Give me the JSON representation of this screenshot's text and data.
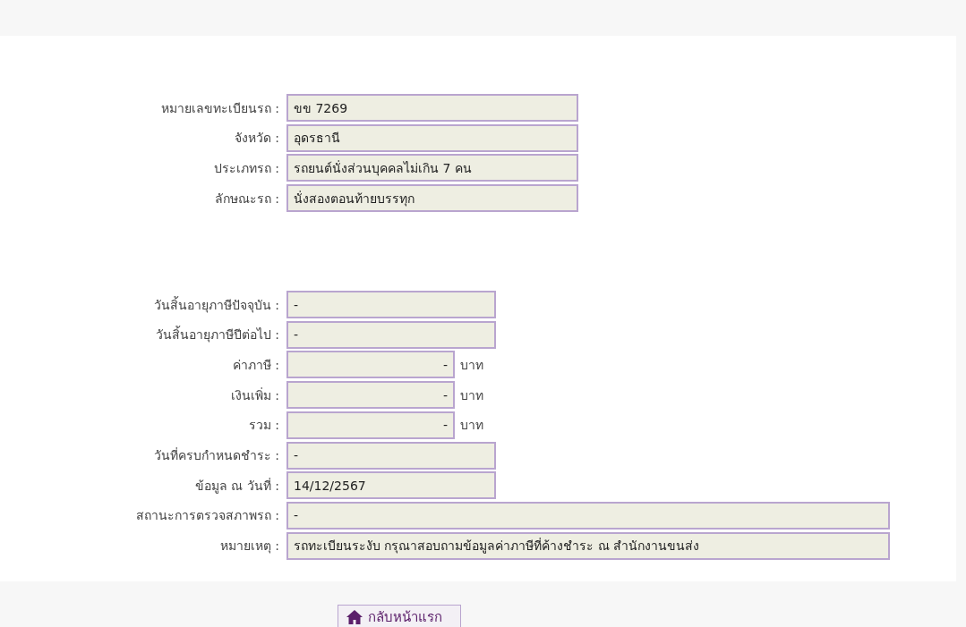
{
  "sections": [
    {
      "rows": [
        {
          "label": "หมายเลขทะเบียนรถ :",
          "value": "ขข 7269",
          "kind": "medium"
        },
        {
          "label": "จังหวัด :",
          "value": "อุดรธานี",
          "kind": "medium"
        },
        {
          "label": "ประเภทรถ :",
          "value": "รถยนต์นั่งส่วนบุคคลไม่เกิน 7 คน",
          "kind": "medium"
        },
        {
          "label": "ลักษณะรถ :",
          "value": "นั่งสองตอนท้ายบรรทุก",
          "kind": "medium"
        }
      ]
    },
    {
      "rows": [
        {
          "label": "วันสิ้นอายุภาษีปัจจุบัน :",
          "value": "-",
          "kind": "short"
        },
        {
          "label": "วันสิ้นอายุภาษีปีต่อไป :",
          "value": "-",
          "kind": "short"
        },
        {
          "label": "ค่าภาษี :",
          "value": "-",
          "kind": "amount",
          "unit": "บาท"
        },
        {
          "label": "เงินเพิ่ม :",
          "value": "-",
          "kind": "amount",
          "unit": "บาท"
        },
        {
          "label": "รวม :",
          "value": "-",
          "kind": "amount",
          "unit": "บาท"
        },
        {
          "label": "วันที่ครบกำหนดชำระ :",
          "value": "-",
          "kind": "short"
        },
        {
          "label": "ข้อมูล ณ วันที่ :",
          "value": "14/12/2567",
          "kind": "short"
        },
        {
          "label": "สถานะการตรวจสภาพรถ :",
          "value": "-",
          "kind": "long"
        },
        {
          "label": "หมายเหตุ :",
          "value": "รถทะเบียนระงับ กรุณาสอบถามข้อมูลค่าภาษีที่ค้างชำระ ณ สำนักงานขนส่ง",
          "kind": "long"
        }
      ]
    }
  ],
  "home_button": {
    "label": "กลับหน้าแรก"
  }
}
